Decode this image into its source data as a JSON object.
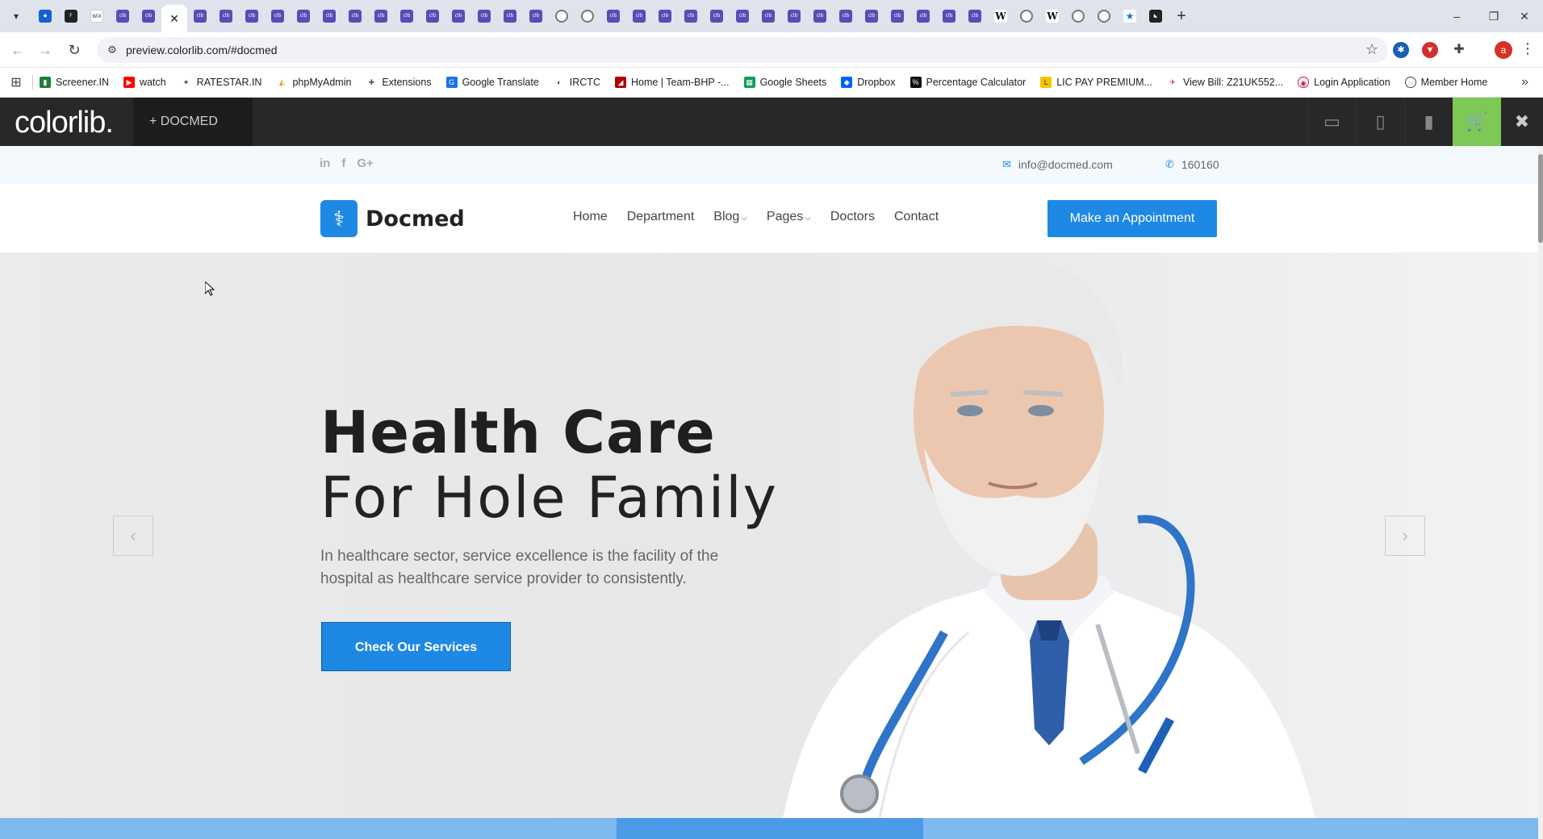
{
  "browser": {
    "active_tab_close": "✕",
    "new_tab": "+",
    "url": "preview.colorlib.com/#docmed",
    "window_controls": [
      "–",
      "❐",
      "✕"
    ],
    "profile_initial": "a"
  },
  "bookmarks": [
    {
      "label": "Screener.IN",
      "color": "#1a7f37",
      "icon": "chart-icon"
    },
    {
      "label": "watch",
      "color": "#ff0000",
      "icon": "youtube-icon"
    },
    {
      "label": "RATESTAR.IN",
      "color": "#333333",
      "icon": "star-icon"
    },
    {
      "label": "phpMyAdmin",
      "color": "#e48a00",
      "icon": "php-icon"
    },
    {
      "label": "Extensions",
      "color": "#555555",
      "icon": "puzzle-icon"
    },
    {
      "label": "Google Translate",
      "color": "#1a73e8",
      "icon": "translate-icon"
    },
    {
      "label": "IRCTC",
      "color": "#1c3f94",
      "icon": "train-icon"
    },
    {
      "label": "Home | Team-BHP -...",
      "color": "#b00000",
      "icon": "bhp-icon"
    },
    {
      "label": "Google Sheets",
      "color": "#0f9d58",
      "icon": "sheets-icon"
    },
    {
      "label": "Dropbox",
      "color": "#0061fe",
      "icon": "dropbox-icon"
    },
    {
      "label": "Percentage Calculator",
      "color": "#111111",
      "icon": "percent-icon"
    },
    {
      "label": "LIC PAY PREMIUM...",
      "color": "#f5c400",
      "icon": "lic-icon"
    },
    {
      "label": "View Bill: Z21UK552...",
      "color": "#d32f2f",
      "icon": "bill-icon"
    },
    {
      "label": "Login Application",
      "color": "#c2185b",
      "icon": "login-icon"
    },
    {
      "label": "Member Home",
      "color": "#444444",
      "icon": "globe-icon"
    }
  ],
  "colorlib": {
    "logo": "colorlib.",
    "theme_label": "+ DOCMED"
  },
  "site": {
    "email": "info@docmed.com",
    "phone": "160160",
    "brand": "Docmed",
    "menu": [
      "Home",
      "Department",
      "Blog",
      "Pages",
      "Doctors",
      "Contact"
    ],
    "appointment": "Make an Appointment",
    "hero": {
      "title": "Health Care",
      "subtitle": "For Hole Family",
      "description": "In healthcare sector, service excellence is the facility of the hospital as healthcare service provider to consistently.",
      "button": "Check Our Services"
    }
  },
  "colors": {
    "accent": "#1e88e5",
    "cart_green": "#7ec855",
    "colorlib_bar": "#282828"
  }
}
